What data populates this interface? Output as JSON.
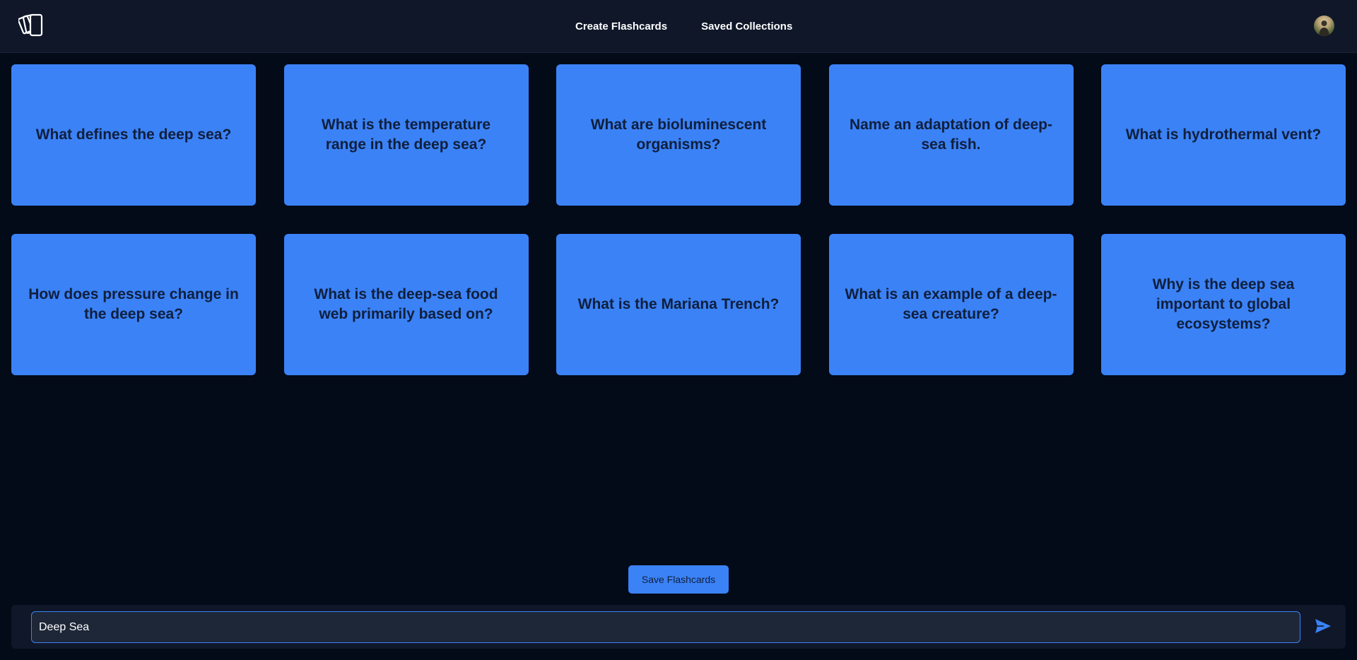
{
  "header": {
    "logo_icon": "cards-stack-icon",
    "nav": [
      {
        "label": "Create Flashcards"
      },
      {
        "label": "Saved Collections"
      }
    ],
    "avatar_icon": "user-avatar"
  },
  "flashcards": [
    {
      "question": "What defines the deep sea?"
    },
    {
      "question": "What is the temperature range in the deep sea?"
    },
    {
      "question": "What are bioluminescent organisms?"
    },
    {
      "question": "Name an adaptation of deep-sea fish."
    },
    {
      "question": "What is hydrothermal vent?"
    },
    {
      "question": "How does pressure change in the deep sea?"
    },
    {
      "question": "What is the deep-sea food web primarily based on?"
    },
    {
      "question": "What is the Mariana Trench?"
    },
    {
      "question": "What is an example of a deep-sea creature?"
    },
    {
      "question": "Why is the deep sea important to global ecosystems?"
    }
  ],
  "actions": {
    "save_label": "Save Flashcards"
  },
  "composer": {
    "value": "Deep Sea",
    "send_icon": "send-icon"
  },
  "colors": {
    "background": "#030a18",
    "header": "#0f1729",
    "accent": "#3b82f6",
    "card_text": "#0f1f3d"
  }
}
